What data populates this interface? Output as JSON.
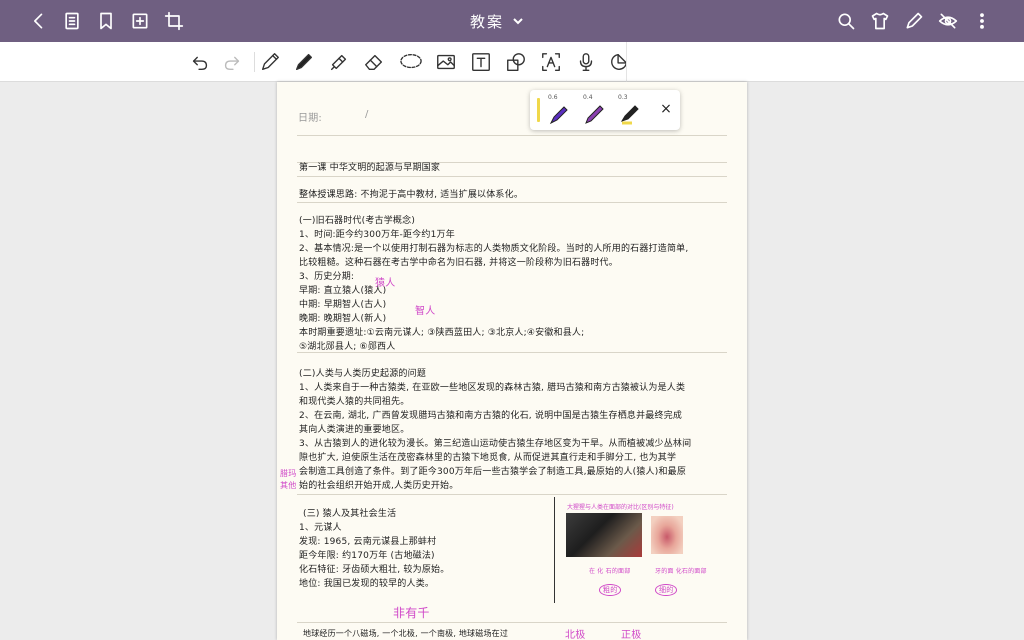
{
  "app": {
    "title": "教案"
  },
  "page": {
    "date_label": "日期:",
    "date_sep": "/",
    "lines": [
      "第一课 中华文明的起源与早期国家",
      "整体授课思路: 不拘泥于高中教材, 适当扩展以体系化。",
      "(一)旧石器时代(考古学概念)",
      "1、时间:距今约300万年-距今约1万年",
      "2、基本情况:是一个以使用打制石器为标志的人类物质文化阶段。当时的人所用的石器打造简单,",
      "比较粗糙。这种石器在考古学中命名为旧石器, 并将这一阶段称为旧石器时代。",
      "3、历史分期:",
      "早期: 直立猿人(猿人)",
      "中期: 早期智人(古人)",
      "晚期: 晚期智人(新人)",
      "本时期重要遗址:①云南元谋人; ③陕西蓝田人; ③北京人;④安徽和县人;",
      "⑤湖北郧县人; ⑥郧西人",
      "(二)人类与人类历史起源的问题",
      "1、人类来自于一种古猿类, 在亚欧一些地区发现的森林古猿, 腊玛古猿和南方古猿被认为是人类",
      "和现代类人猿的共同祖先。",
      "2、在云南, 湖北, 广西曾发现腊玛古猿和南方古猿的化石, 说明中国是古猿生存栖息并最终完成",
      "其向人类演进的重要地区。",
      "3、从古猿到人的进化较为漫长。第三纪造山运动使古猿生存地区变为干旱。从而植被减少丛林间",
      "隙也扩大, 迫使原生活在茂密森林里的古猿下地觅食, 从而促进其直行走和手脚分工, 也为其学",
      "会制造工具创造了条件。到了距今300万年后一些古猿学会了制造工具,最原始的人(猿人)和最原",
      "始的社会组织开始开成,人类历史开始。",
      "(三) 猿人及其社会生活",
      "1、元谋人",
      "发现: 1965, 云南元谋县上那蚌村",
      "距今年限: 约170万年 (古地磁法)",
      "化石特征: 牙齿硕大粗壮, 较为原始。",
      "地位: 我国已发现的较早的人类。",
      "地球经历一个八磁场, 一个北极, 一个南极, 地球磁场在过"
    ],
    "annotations": {
      "ape_man": "猿人",
      "zhiren": "智人",
      "apes_note_1": "腊玛",
      "apes_note_2": "其他",
      "paleomagnetic": "非有千",
      "north": "北极",
      "south": "正极",
      "fig_caption": "大猩猩与人类在面部的对比(区别与特征)",
      "fig_note_1": "在 化 石的面部",
      "fig_note_2": "牙的面 化石的面部",
      "fig_circle_1": "粗的",
      "fig_circle_2": "细的"
    }
  },
  "pen_palette": {
    "sizes": [
      "0.6",
      "0.4",
      "0.3"
    ],
    "close": "×",
    "colors": {
      "marker": "#5a2fbf",
      "pen": "#8a3fb0",
      "highlight": "#f0d84a"
    }
  }
}
